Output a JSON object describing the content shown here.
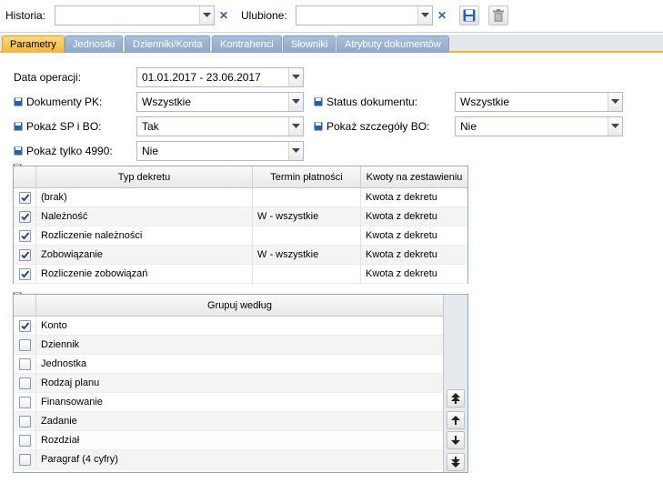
{
  "toolbar": {
    "history_label": "Historia:",
    "history_value": "",
    "favorites_label": "Ulubione:",
    "favorites_value": ""
  },
  "tabs": [
    {
      "label": "Parametry",
      "active": true
    },
    {
      "label": "Jednostki",
      "active": false
    },
    {
      "label": "Dzienniki/Konta",
      "active": false
    },
    {
      "label": "Kontrahenci",
      "active": false
    },
    {
      "label": "Słowniki",
      "active": false
    },
    {
      "label": "Atrybuty dokumentów",
      "active": false
    }
  ],
  "form": {
    "date_label": "Data operacji:",
    "date_value": "01.01.2017 - 23.06.2017",
    "doc_pk_label": "Dokumenty PK:",
    "doc_pk_value": "Wszystkie",
    "status_label": "Status dokumentu:",
    "status_value": "Wszystkie",
    "sp_bo_label": "Pokaż SP i BO:",
    "sp_bo_value": "Tak",
    "bo_details_label": "Pokaż szczegóły BO:",
    "bo_details_value": "Nie",
    "only4990_label": "Pokaż tylko 4990:",
    "only4990_value": "Nie"
  },
  "decree_grid": {
    "headers": [
      "Typ dekretu",
      "Termin płatności",
      "Kwoty na zestawieniu"
    ],
    "rows": [
      {
        "checked": true,
        "type": "(brak)",
        "term": "",
        "amount": "Kwota z dekretu"
      },
      {
        "checked": true,
        "type": "Należność",
        "term": "W - wszystkie",
        "amount": "Kwota z dekretu"
      },
      {
        "checked": true,
        "type": "Rozliczenie należności",
        "term": "",
        "amount": "Kwota z dekretu"
      },
      {
        "checked": true,
        "type": "Zobowiązanie",
        "term": "W - wszystkie",
        "amount": "Kwota z dekretu"
      },
      {
        "checked": true,
        "type": "Rozliczenie zobowiązań",
        "term": "",
        "amount": "Kwota z dekretu"
      }
    ]
  },
  "group_grid": {
    "header": "Grupuj według",
    "rows": [
      {
        "checked": true,
        "label": "Konto"
      },
      {
        "checked": false,
        "label": "Dziennik"
      },
      {
        "checked": false,
        "label": "Jednostka"
      },
      {
        "checked": false,
        "label": "Rodzaj planu"
      },
      {
        "checked": false,
        "label": "Finansowanie"
      },
      {
        "checked": false,
        "label": "Zadanie"
      },
      {
        "checked": false,
        "label": "Rozdział"
      },
      {
        "checked": false,
        "label": "Paragraf (4 cyfry)"
      }
    ]
  },
  "colors": {
    "accent_tab": "#f4b23c",
    "tab_inactive": "#8ea8c8",
    "icon_blue": "#2f5f9e"
  }
}
